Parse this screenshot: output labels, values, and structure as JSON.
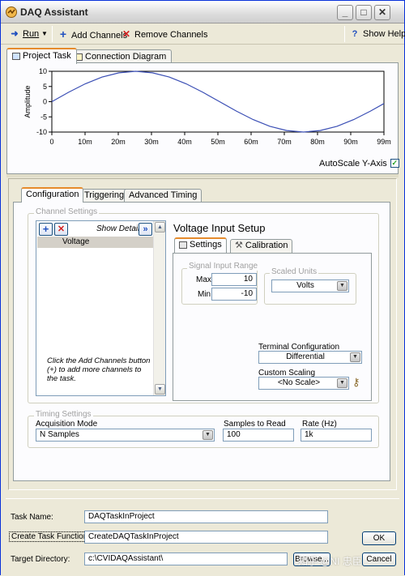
{
  "window": {
    "title": "DAQ Assistant"
  },
  "toolbar": {
    "run_label": "Run",
    "add_channels_label": "Add Channels",
    "remove_channels_label": "Remove Channels",
    "show_help_label": "Show Help"
  },
  "top_tabs": [
    {
      "label": "Project Task",
      "active": true
    },
    {
      "label": "Connection Diagram",
      "active": false
    }
  ],
  "graph": {
    "autoscale_label": "AutoScale Y-Axis",
    "autoscale_checked": true
  },
  "chart_data": {
    "type": "line",
    "title": "",
    "xlabel": "",
    "ylabel": "Amplitude",
    "x_tick_labels": [
      "0",
      "10m",
      "20m",
      "30m",
      "40m",
      "50m",
      "60m",
      "70m",
      "80m",
      "90m",
      "99m"
    ],
    "y_tick_labels": [
      "10",
      "5",
      "0",
      "-5",
      "-10"
    ],
    "xlim": [
      0,
      0.099
    ],
    "ylim": [
      -10,
      10
    ],
    "grid": false,
    "series": [
      {
        "x": [
          0,
          0.005,
          0.01,
          0.015,
          0.02,
          0.025,
          0.03,
          0.035,
          0.04,
          0.045,
          0.05,
          0.055,
          0.06,
          0.065,
          0.07,
          0.075,
          0.08,
          0.085,
          0.09,
          0.095,
          0.099
        ],
        "y": [
          0,
          3.1,
          5.9,
          8.1,
          9.5,
          10,
          9.5,
          8.1,
          5.9,
          3.1,
          0,
          -3.1,
          -5.9,
          -8.1,
          -9.5,
          -10,
          -9.5,
          -8.1,
          -5.9,
          -3.1,
          -0.6
        ]
      }
    ]
  },
  "config_tabs": [
    {
      "label": "Configuration",
      "active": true
    },
    {
      "label": "Triggering",
      "active": false
    },
    {
      "label": "Advanced Timing",
      "active": false
    }
  ],
  "channel_settings": {
    "group_label": "Channel Settings",
    "show_details_label": "Show Details",
    "channels": [
      "Voltage"
    ],
    "hint": "Click the Add Channels button (+) to add more channels to the task."
  },
  "voltage_setup": {
    "title": "Voltage Input Setup",
    "subtabs": [
      {
        "label": "Settings",
        "active": true
      },
      {
        "label": "Calibration",
        "active": false
      }
    ],
    "signal_range_label": "Signal Input Range",
    "max_label": "Max",
    "max_value": "10",
    "min_label": "Min",
    "min_value": "-10",
    "scaled_units_label": "Scaled Units",
    "scaled_units_value": "Volts",
    "terminal_config_label": "Terminal Configuration",
    "terminal_config_value": "Differential",
    "custom_scaling_label": "Custom Scaling",
    "custom_scaling_value": "<No Scale>"
  },
  "timing": {
    "group_label": "Timing Settings",
    "acq_mode_label": "Acquisition Mode",
    "acq_mode_value": "N Samples",
    "samples_label": "Samples to Read",
    "samples_value": "100",
    "rate_label": "Rate (Hz)",
    "rate_value": "1k"
  },
  "bottom": {
    "task_name_label": "Task Name:",
    "task_name_value": "DAQTaskInProject",
    "create_fn_label": "Create Task Function:",
    "create_fn_value": "CreateDAQTaskInProject",
    "target_dir_label": "Target Directory:",
    "target_dir_value": "c:\\CVIDAQAssistant\\",
    "ok_label": "OK",
    "browse_label": "Browse...",
    "cancel_label": "Cancel"
  },
  "watermark": "知乎 @NI 忠臣"
}
